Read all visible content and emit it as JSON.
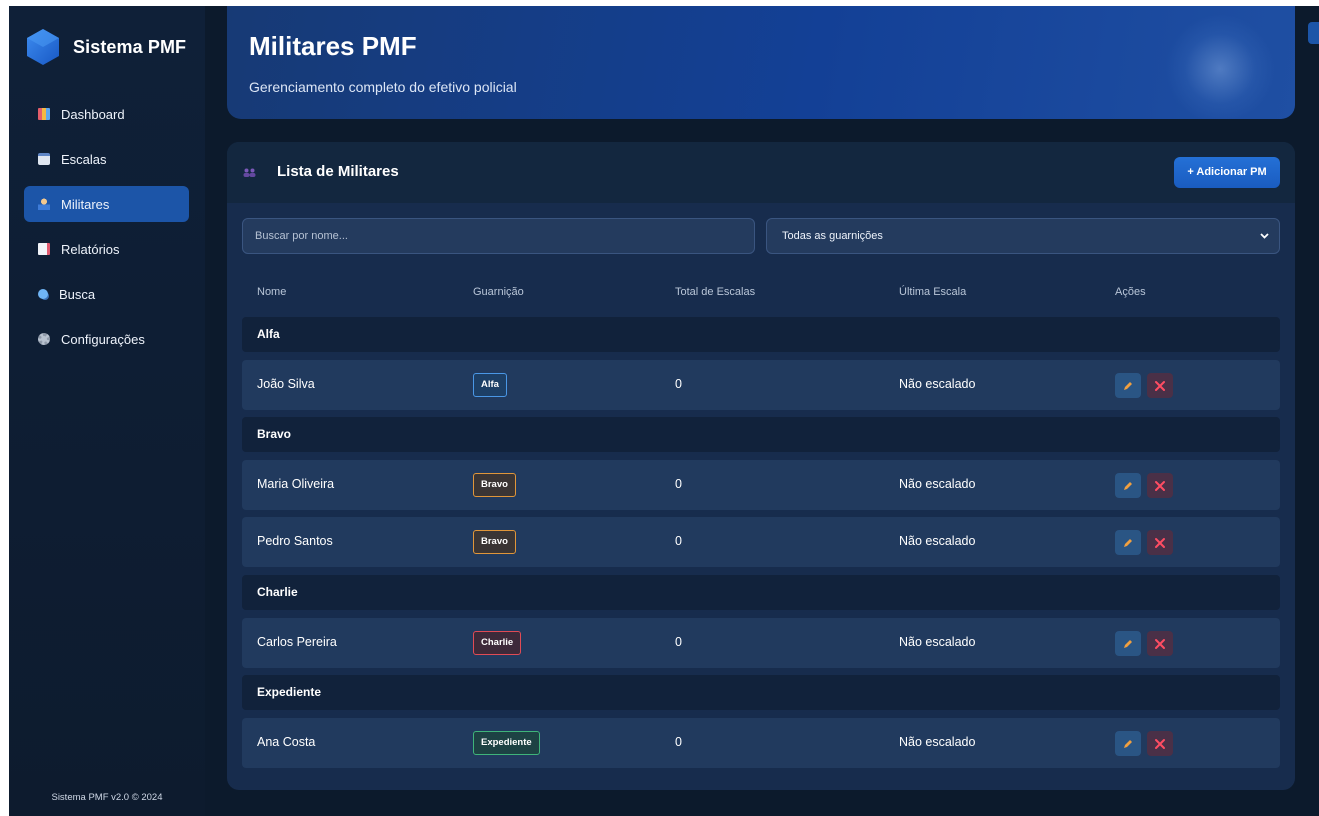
{
  "sidebar": {
    "brand": "Sistema PMF",
    "items": [
      {
        "label": "Dashboard",
        "icon": "chart-icon",
        "active": false
      },
      {
        "label": "Escalas",
        "icon": "calendar-icon",
        "active": false
      },
      {
        "label": "Militares",
        "icon": "officer-icon",
        "active": true
      },
      {
        "label": "Relatórios",
        "icon": "report-icon",
        "active": false
      },
      {
        "label": "Busca",
        "icon": "search-icon",
        "active": false
      },
      {
        "label": "Configurações",
        "icon": "gear-icon",
        "active": false
      }
    ],
    "footer": "Sistema PMF v2.0 © 2024"
  },
  "header": {
    "title": "Militares PMF",
    "subtitle": "Gerenciamento completo do efetivo policial"
  },
  "card": {
    "title": "Lista de Militares",
    "add_button": "+ Adicionar PM",
    "search_placeholder": "Buscar por nome...",
    "filter_selected": "Todas as guarnições"
  },
  "table": {
    "headers": [
      "Nome",
      "Guarnição",
      "Total de Escalas",
      "Última Escala",
      "Ações"
    ],
    "groups": [
      {
        "name": "Alfa",
        "rows": [
          {
            "nome": "João Silva",
            "guarnicao": "Alfa",
            "total": "0",
            "ultima": "Não escalado"
          }
        ]
      },
      {
        "name": "Bravo",
        "rows": [
          {
            "nome": "Maria Oliveira",
            "guarnicao": "Bravo",
            "total": "0",
            "ultima": "Não escalado"
          },
          {
            "nome": "Pedro Santos",
            "guarnicao": "Bravo",
            "total": "0",
            "ultima": "Não escalado"
          }
        ]
      },
      {
        "name": "Charlie",
        "rows": [
          {
            "nome": "Carlos Pereira",
            "guarnicao": "Charlie",
            "total": "0",
            "ultima": "Não escalado"
          }
        ]
      },
      {
        "name": "Expediente",
        "rows": [
          {
            "nome": "Ana Costa",
            "guarnicao": "Expediente",
            "total": "0",
            "ultima": "Não escalado"
          }
        ]
      }
    ]
  },
  "colors": {
    "accent": "#1c55a8",
    "alfa": "#4a97e6",
    "bravo": "#e0963a",
    "charlie": "#e04b55",
    "expediente": "#3fb47a"
  }
}
